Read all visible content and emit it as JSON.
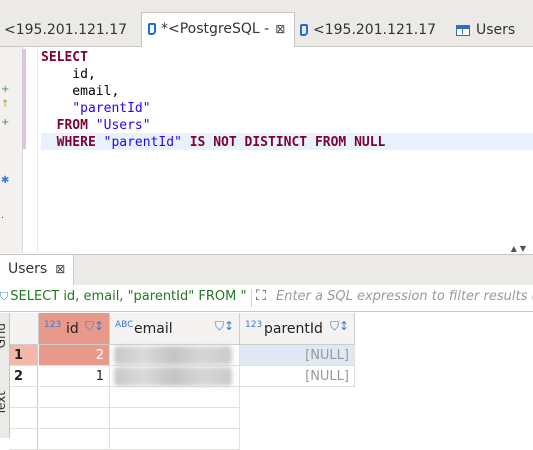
{
  "editor_tabs": [
    {
      "label": "<195.201.121.17",
      "icon": "sql-editor-icon",
      "active": false
    },
    {
      "label": "*<PostgreSQL -",
      "icon": "sql-editor-icon",
      "active": true,
      "close": "⊠"
    },
    {
      "label": "<195.201.121.17",
      "icon": "sql-editor-icon",
      "active": false
    },
    {
      "label": "Users",
      "icon": "table-icon",
      "active": false
    }
  ],
  "editor": {
    "sql_lines": [
      {
        "kw": "SELECT",
        "rest": ""
      },
      {
        "plain": "    id,"
      },
      {
        "plain": "    email,"
      },
      {
        "str": "    \"parentId\""
      },
      {
        "kw": "  FROM",
        "str": " \"Users\""
      },
      {
        "kw": "  WHERE",
        "str": " \"parentId\"",
        "kw2": " IS NOT DISTINCT FROM NULL"
      }
    ]
  },
  "results": {
    "tab_label": "Users",
    "tab_close": "⊠",
    "filter_query": "SELECT id, email, \"parentId\" FROM \"",
    "filter_placeholder": "Enter a SQL expression to filter results (",
    "side_tabs": [
      "Grid",
      "Text"
    ],
    "columns": [
      {
        "type": "123",
        "name": "id"
      },
      {
        "type": "ABC",
        "name": "email"
      },
      {
        "type": "123",
        "name": "parentId"
      }
    ],
    "rows": [
      {
        "row": "1",
        "id": "2",
        "email": "",
        "parentId": "[NULL]",
        "selected": true
      },
      {
        "row": "2",
        "id": "1",
        "email": "",
        "parentId": "[NULL]",
        "selected": false
      }
    ]
  },
  "colors": {
    "keyword": "#7f0033",
    "string": "#2a00ff",
    "selected_cell": "#e8998a",
    "selected_row_header": "#f2b9aa"
  }
}
